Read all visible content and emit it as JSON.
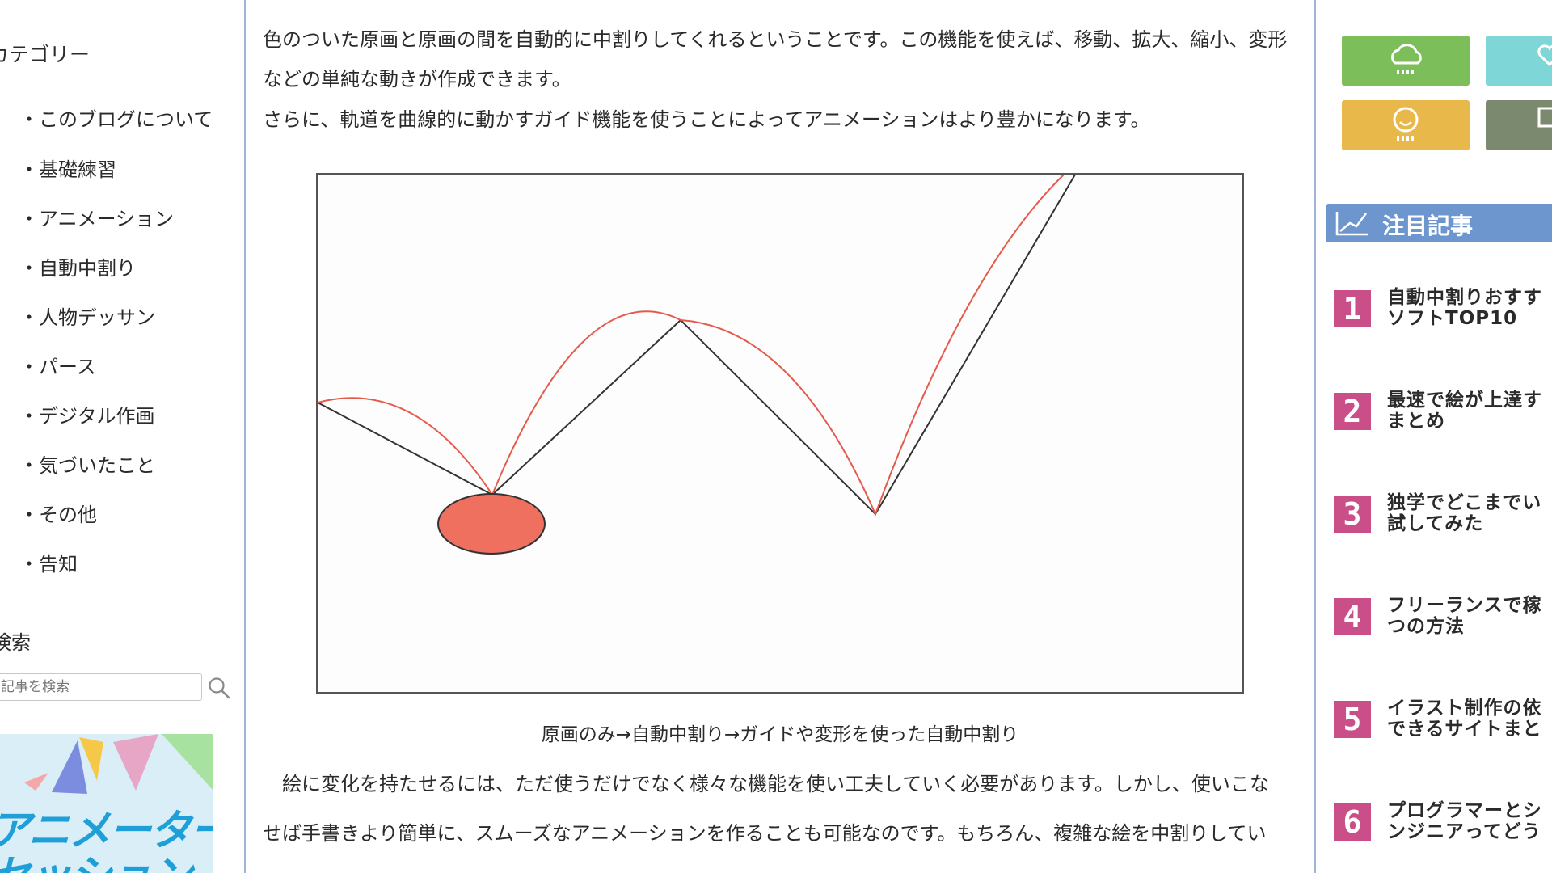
{
  "left_sidebar": {
    "category_heading": "カテゴリー",
    "categories": [
      "・このブログについて",
      "・基礎練習",
      "・アニメーション",
      "・自動中割り",
      "・人物デッサン",
      "・パース",
      "・デジタル作画",
      "・気づいたこと",
      "・その他",
      "・告知"
    ],
    "search_heading": "検索",
    "search_placeholder": "記事を検索",
    "banner_text": "アニメーターズ\nセッション"
  },
  "article": {
    "paragraph_1_line_1": "色のついた原画と原画の間を自動的に中割りしてくれるということです。この機能を使えば、移動、拡大、縮小、変形",
    "paragraph_1_line_2": "などの単純な動きが作成できます。",
    "paragraph_2": "さらに、軌道を曲線的に動かすガイド機能を使うことによってアニメーションはより豊かになります。",
    "figure_caption": "原画のみ→自動中割り→ガイドや変形を使った自動中割り",
    "paragraph_3_line_1": "　絵に変化を持たせるには、ただ使うだけでなく様々な機能を使い工夫していく必要があります。しかし、使いこな",
    "paragraph_3_line_2": "せば手書きより簡単に、スムーズなアニメーションを作ることも可能なのです。もちろん、複雑な絵を中割りしてい"
  },
  "right_sidebar": {
    "category_tiles": [
      {
        "icon": "cloud-icon",
        "color": "#7cbf5a"
      },
      {
        "icon": "heart-icon",
        "color": "#7fd6d6"
      },
      {
        "icon": "smile-icon",
        "color": "#e8b84a"
      },
      {
        "icon": "monitor-icon",
        "color": "#7b8a6e"
      }
    ],
    "featured_heading": "注目記事",
    "featured_articles": [
      {
        "rank": "1",
        "line1": "自動中割りおすす",
        "line2": "ソフトTOP10"
      },
      {
        "rank": "2",
        "line1": "最速で絵が上達す",
        "line2": "まとめ"
      },
      {
        "rank": "3",
        "line1": "独学でどこまでい",
        "line2": "試してみた"
      },
      {
        "rank": "4",
        "line1": "フリーランスで稼",
        "line2": "つの方法"
      },
      {
        "rank": "5",
        "line1": "イラスト制作の依",
        "line2": "できるサイトまと"
      },
      {
        "rank": "6",
        "line1": "プログラマーとシ",
        "line2": "ンジニアってどう"
      }
    ]
  },
  "colors": {
    "accent_blue": "#6d96cf",
    "rank_pink": "#ca4e87",
    "ball_red": "#f07060",
    "guide_line": "#333333",
    "curve_red": "#e55a4a"
  }
}
